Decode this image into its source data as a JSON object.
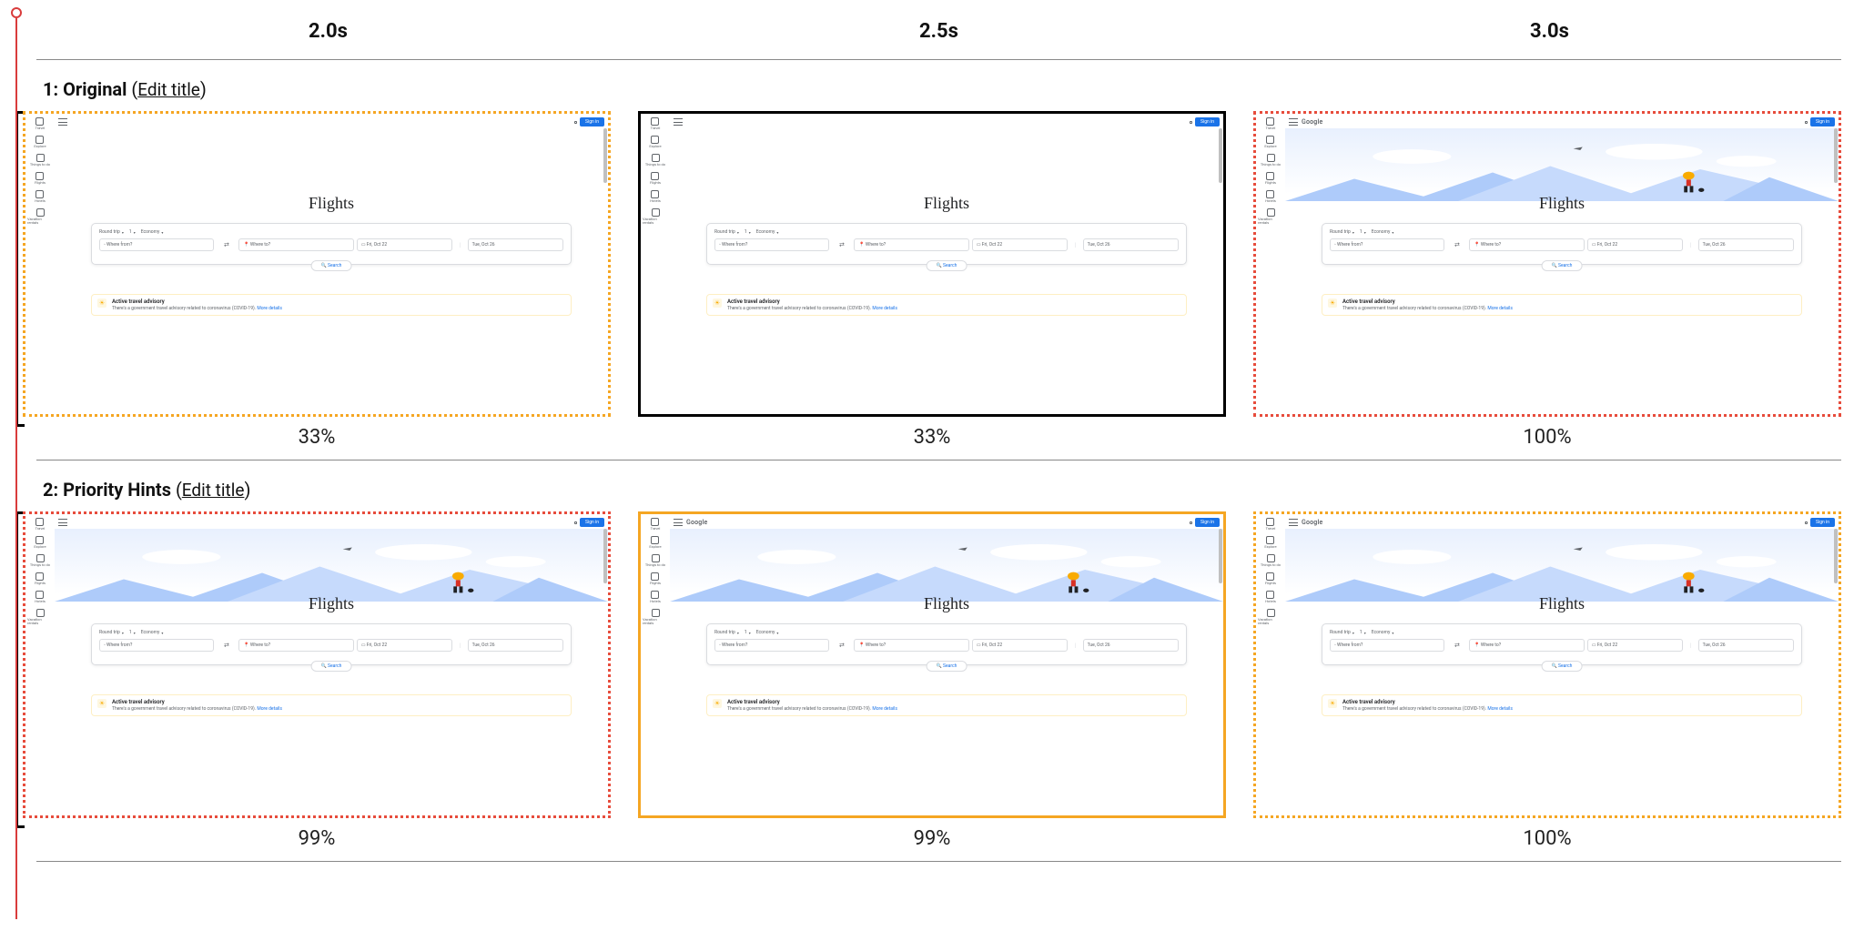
{
  "time_labels": [
    "2.0s",
    "2.5s",
    "3.0s"
  ],
  "rows": [
    {
      "index": "1",
      "title": "Original",
      "edit_label": "Edit title",
      "frames": [
        {
          "border": "dotted-orange",
          "pct": "33%",
          "hero_loaded": false,
          "logo_visible": false
        },
        {
          "border": "solid-black",
          "pct": "33%",
          "hero_loaded": false,
          "logo_visible": false
        },
        {
          "border": "dotted-red",
          "pct": "100%",
          "hero_loaded": true,
          "logo_visible": true
        }
      ]
    },
    {
      "index": "2",
      "title": "Priority Hints",
      "edit_label": "Edit title",
      "frames": [
        {
          "border": "dotted-red",
          "pct": "99%",
          "hero_loaded": true,
          "logo_visible": false
        },
        {
          "border": "solid-orange",
          "pct": "99%",
          "hero_loaded": true,
          "logo_visible": true
        },
        {
          "border": "dotted-orange",
          "pct": "100%",
          "hero_loaded": true,
          "logo_visible": true
        }
      ]
    }
  ],
  "screenshot": {
    "logo_text": "Google",
    "signin_label": "Sign in",
    "sidebar": [
      "Travel",
      "Explore",
      "Things to do",
      "Flights",
      "Hotels",
      "Vacation rentals"
    ],
    "page_title": "Flights",
    "chips": {
      "trip": "Round trip",
      "pax": "1",
      "class": "Economy"
    },
    "fields": {
      "from_placeholder": "Where from?",
      "to_placeholder": "Where to?",
      "date_out": "Fri, Oct 22",
      "date_ret": "Tue, Oct 26"
    },
    "search_label": "Search",
    "advisory": {
      "title": "Active travel advisory",
      "body": "There's a government travel advisory related to coronavirus (COVID-19).",
      "link": "More details"
    }
  }
}
